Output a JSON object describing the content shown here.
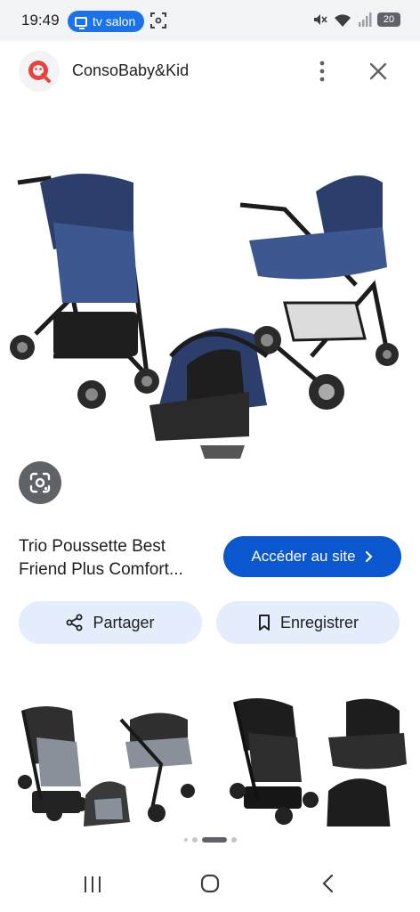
{
  "status_bar": {
    "time": "19:49",
    "cast_label": "tv salon",
    "battery": "20"
  },
  "header": {
    "site_name": "ConsoBaby&Kid",
    "logo_icon": "q-logo-icon",
    "more_icon": "more-vert-icon",
    "close_icon": "close-icon"
  },
  "image": {
    "subject": "stroller-trio-navy",
    "lens_icon": "lens-search-icon"
  },
  "product": {
    "title": "Trio Poussette Best Friend Plus Comfort..."
  },
  "actions": {
    "visit_label": "Accéder au site",
    "share_label": "Partager",
    "save_label": "Enregistrer"
  },
  "related": [
    {
      "subject": "stroller-trio-grey"
    },
    {
      "subject": "stroller-trio-black"
    }
  ],
  "pager": {
    "count": 5,
    "active": 2
  },
  "colors": {
    "primary": "#0b57d0",
    "tonal": "#e3edfb",
    "cast": "#1a73e8",
    "logo_red": "#e8433f"
  }
}
